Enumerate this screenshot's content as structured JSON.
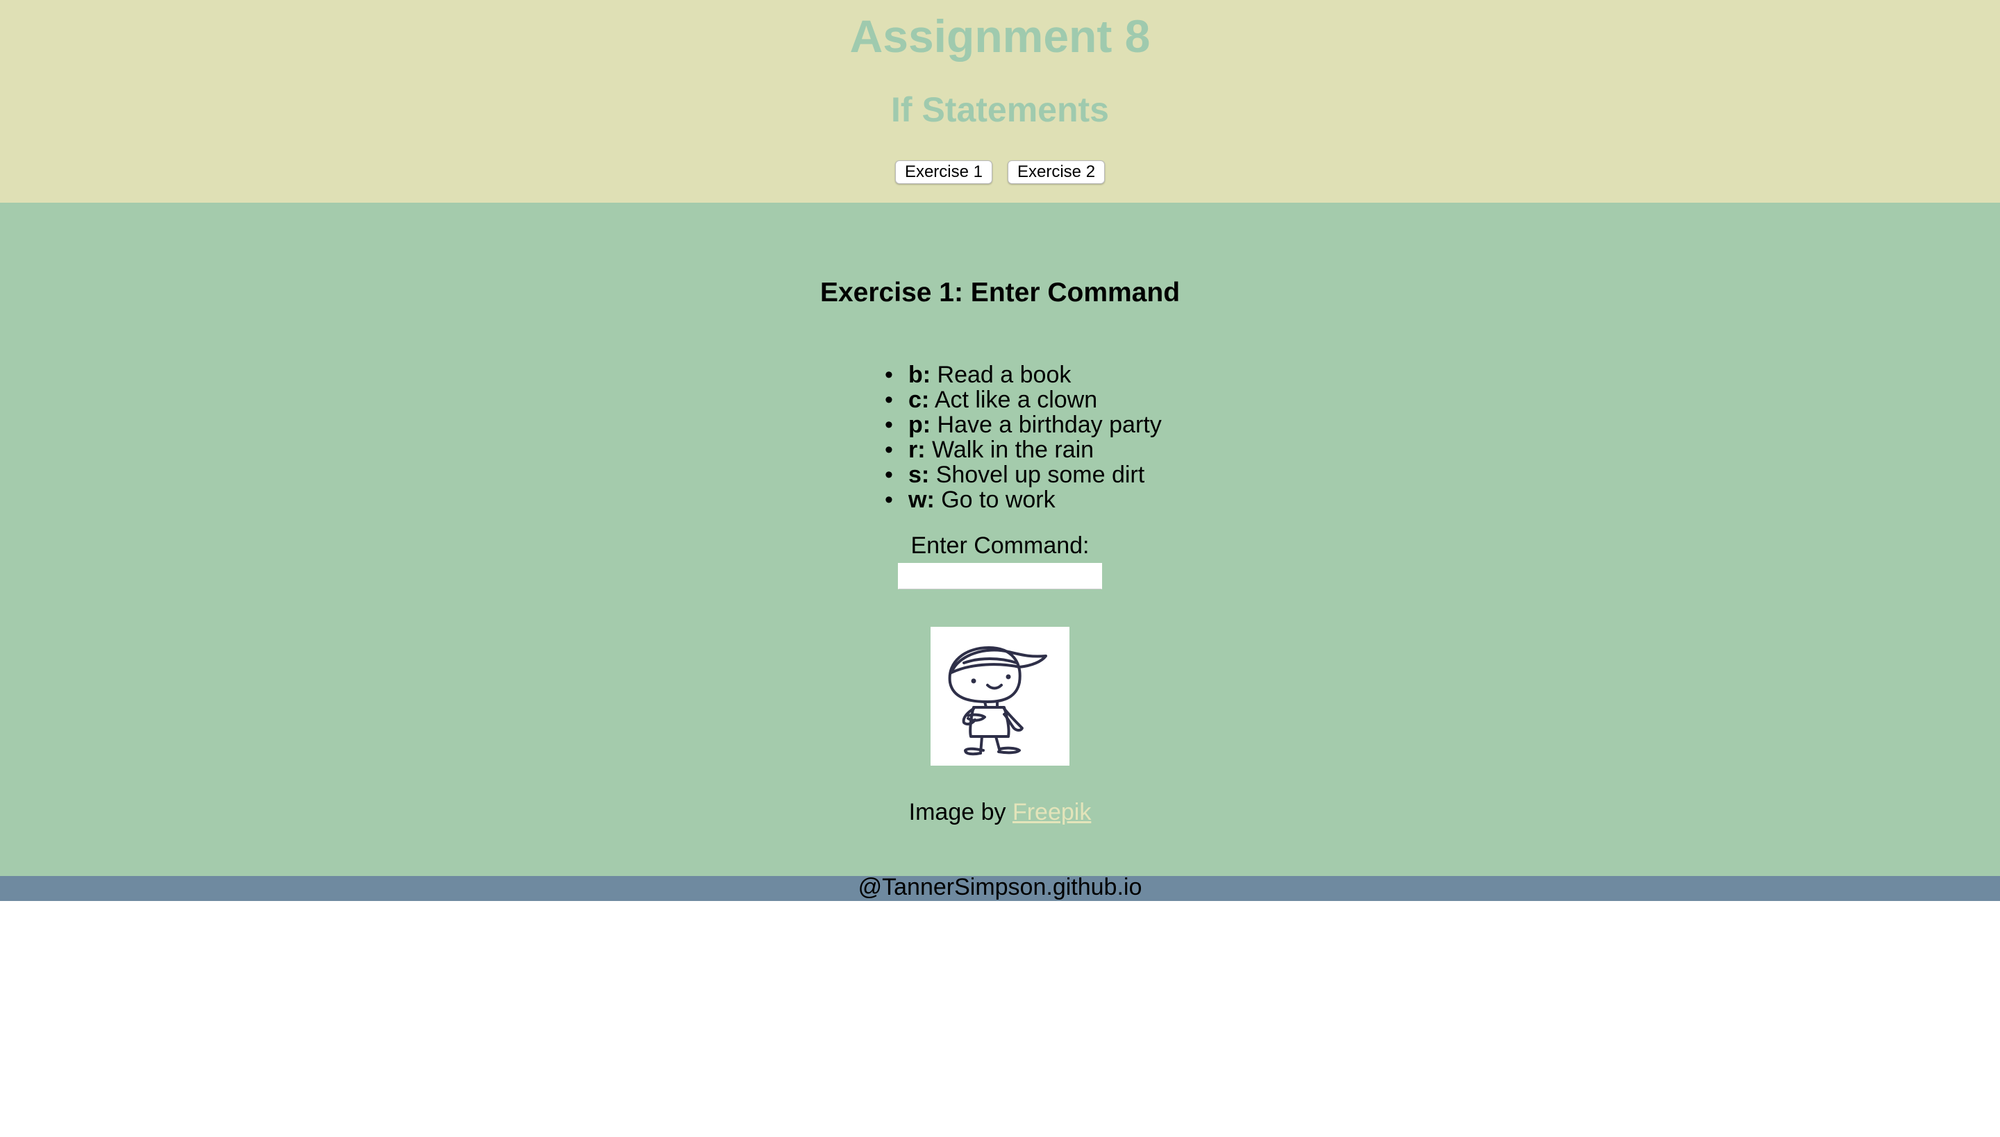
{
  "header": {
    "title": "Assignment 8",
    "subtitle": "If Statements",
    "nav_buttons": [
      "Exercise 1",
      "Exercise 2"
    ]
  },
  "exercise": {
    "heading": "Exercise 1: Enter Command",
    "commands": [
      {
        "key": "b:",
        "action": "Read a book"
      },
      {
        "key": "c:",
        "action": "Act like a clown"
      },
      {
        "key": "p:",
        "action": "Have a birthday party"
      },
      {
        "key": "r:",
        "action": "Walk in the rain"
      },
      {
        "key": "s:",
        "action": "Shovel up some dirt"
      },
      {
        "key": "w:",
        "action": "Go to work"
      }
    ],
    "input_label": "Enter Command:",
    "input_value": "",
    "image_icon": "cartoon-boy-with-cap",
    "credit_prefix": "Image by",
    "credit_link": "Freepik"
  },
  "footer": {
    "text": "@TannerSimpson.github.io"
  },
  "colors": {
    "header_bg": "#dfe0b5",
    "header_text": "#9fcaae",
    "main_bg": "#a4cbac",
    "footer_bg": "#6f8aa0",
    "link": "#e3e4ba"
  }
}
